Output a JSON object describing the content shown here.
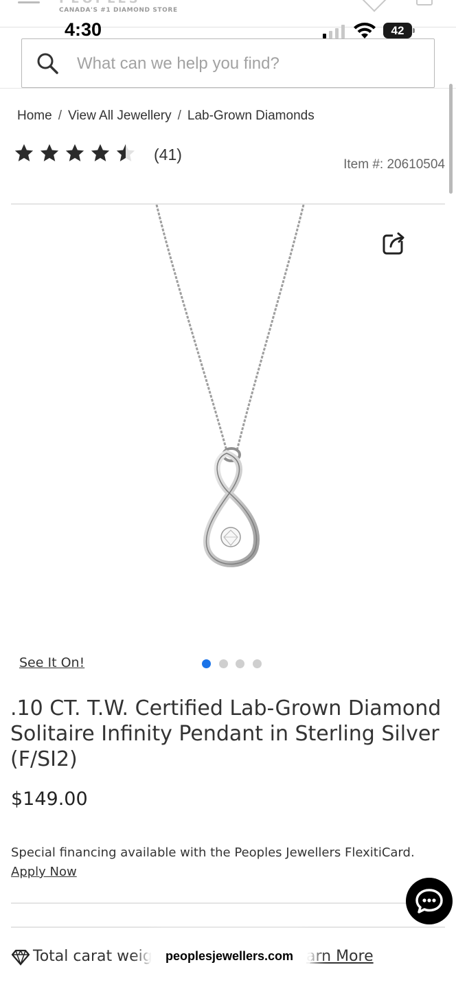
{
  "header": {
    "tagline": "CANADA'S #1 DIAMOND STORE"
  },
  "status_bar": {
    "time": "4:30",
    "battery": "42"
  },
  "search": {
    "placeholder": "What can we help you find?"
  },
  "breadcrumb": {
    "items": [
      "Home",
      "View All Jewellery",
      "Lab-Grown Diamonds"
    ],
    "separator": "/"
  },
  "rating": {
    "stars": 4.5,
    "max_stars": 5,
    "review_count": "(41)"
  },
  "item_number": "Item #: 20610504",
  "gallery": {
    "see_it_on_label": "See It On!",
    "dot_count": 4,
    "active_dot": 0,
    "active_color": "#1a73e8",
    "inactive_color": "#cfcfcf"
  },
  "product": {
    "title": ".10 CT. T.W. Certified Lab-Grown Diamond Solitaire Infinity Pendant in Sterling Silver (F/SI2)",
    "price": "$149.00"
  },
  "financing": {
    "text": "Special financing available with the Peoples Jewellers FlexitiCard.",
    "link": "Apply Now"
  },
  "carat_row": {
    "label": "Total carat weig",
    "learn_more": "arn More"
  },
  "browser": {
    "url": "peoplesjewellers.com"
  }
}
